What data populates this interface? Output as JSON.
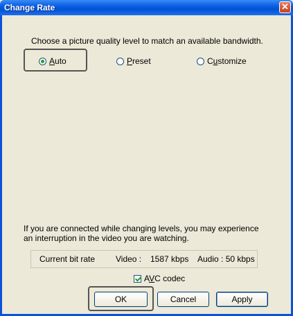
{
  "window": {
    "title": "Change Rate",
    "close_symbol": "✕"
  },
  "intro_text": "Choose a picture quality level to match an available bandwidth.",
  "quality_options": [
    {
      "label": "Auto",
      "mnemonic": "A",
      "rest": "uto",
      "selected": true
    },
    {
      "label": "Preset",
      "mnemonic": "P",
      "rest": "reset",
      "selected": false
    },
    {
      "label": "Customize",
      "prefix": "C",
      "mnemonic": "u",
      "rest": "stomize",
      "selected": false
    }
  ],
  "note_line1": "If you are connected while changing levels, you may experience",
  "note_line2": "an interruption in the video you are watching.",
  "bitrate": {
    "label": "Current bit rate",
    "video_label": "Video :",
    "video_value": "1587 kbps",
    "audio_text": "Audio : 50 kbps"
  },
  "avc": {
    "prefix": "A",
    "mnemonic": "V",
    "rest": "C codec",
    "checked": true
  },
  "buttons": {
    "ok": "OK",
    "cancel": "Cancel",
    "apply": "Apply"
  },
  "colors": {
    "titlebar": "#0a5ee0",
    "dialog_bg": "#ece9d8",
    "radio_dot": "#21a121"
  }
}
